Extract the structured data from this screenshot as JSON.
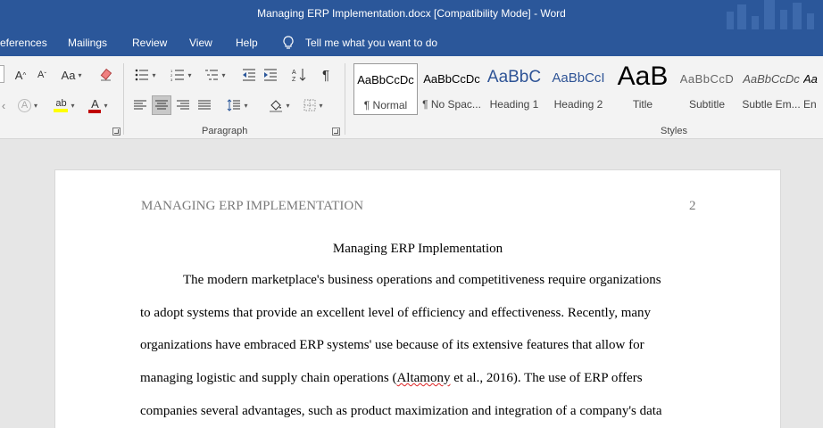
{
  "window": {
    "title": "Managing ERP Implementation.docx [Compatibility Mode]  -  Word"
  },
  "tabs": [
    "eferences",
    "Mailings",
    "Review",
    "View",
    "Help"
  ],
  "tell_me": "Tell me what you want to do",
  "ribbon": {
    "font_group": {
      "grow": "A",
      "shrink": "A",
      "change_case": "Aa",
      "text_effects": "A",
      "font_color": "A"
    },
    "paragraph_label": "Paragraph",
    "styles_label": "Styles",
    "styles": [
      {
        "sample": "AaBbCcDc",
        "name": "¶ Normal"
      },
      {
        "sample": "AaBbCcDc",
        "name": "¶ No Spac..."
      },
      {
        "sample": "AaBbC",
        "name": "Heading 1"
      },
      {
        "sample": "AaBbCcI",
        "name": "Heading 2"
      },
      {
        "sample": "AaB",
        "name": "Title"
      },
      {
        "sample": "AaBbCcD",
        "name": "Subtitle"
      },
      {
        "sample": "AaBbCcDc",
        "name": "Subtle Em..."
      },
      {
        "sample": "Aa",
        "name": "En"
      }
    ],
    "colors": {
      "highlight": "#ffff00",
      "font_color": "#c00000"
    }
  },
  "document": {
    "running_head": "MANAGING ERP IMPLEMENTATION",
    "page_number": "2",
    "heading": "Managing ERP Implementation",
    "lines": [
      "The modern marketplace's business operations and competitiveness require organizations",
      "to adopt systems that provide an excellent level of efficiency and effectiveness. Recently, many",
      "organizations have embraced ERP systems' use because of its extensive features that allow for",
      "companies several advantages, such as product maximization and integration of a company's data"
    ],
    "line4": {
      "before": "managing logistic and supply chain operations (",
      "misspelled": "Altamony",
      "after": " et al., 2016). The use of ERP offers"
    }
  },
  "colors": {
    "titlebar": "#2b579a",
    "ribbon": "#f3f3f3",
    "canvas": "#e6e6e6"
  }
}
